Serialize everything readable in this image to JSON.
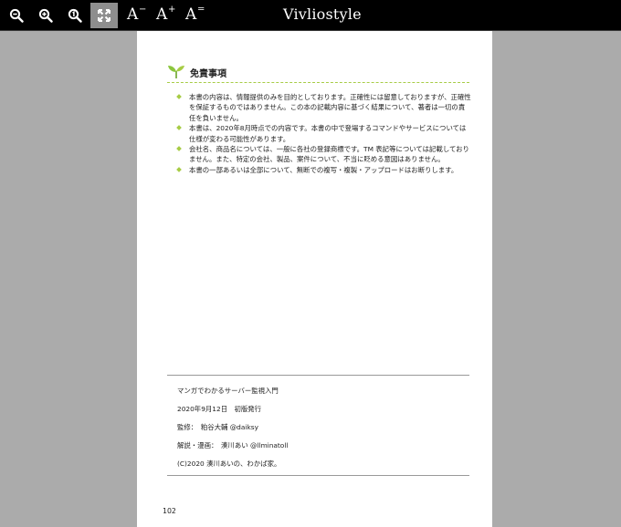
{
  "toolbar": {
    "brand": "Vivliostyle",
    "font_smaller_label": "A",
    "font_smaller_mod": "−",
    "font_larger_label": "A",
    "font_larger_mod": "+",
    "font_reset_label": "A",
    "font_reset_mod": "=",
    "icons": [
      "zoom-out-icon",
      "zoom-in-icon",
      "zoom-actual-size-icon",
      "fit-to-screen-icon"
    ]
  },
  "page": {
    "heading": "免責事項",
    "bullets": [
      "本書の内容は、情報提供のみを目的としております。正確性には留意しておりますが、正確性を保証するものではありません。この本の記載内容に基づく結果について、著者は一切の責任を負いません。",
      "本書は、2020年8月時点での内容です。本書の中で登場するコマンドやサービスについては仕様が変わる可能性があります。",
      "会社名、商品名については、一般に各社の登録商標です。TM 表記等については記載しておりません。また、特定の会社、製品、案件について、不当に貶める意図はありません。",
      "本書の一部あるいは全部について、無断での複写・複製・アップロードはお断りします。"
    ],
    "colophon": [
      "マンガでわかるサーバー監視入門",
      "2020年9月12日　初版発行",
      "監修：　粕谷大輔 @daiksy",
      "解説・漫画：　湊川あい @llminatoll",
      "(C)2020 湊川あいの、わかば家。"
    ],
    "page_number": "102"
  },
  "colors": {
    "toolbar_bg": "#000000",
    "viewer_bg": "#ababab",
    "accent_green": "#a7cc45"
  }
}
